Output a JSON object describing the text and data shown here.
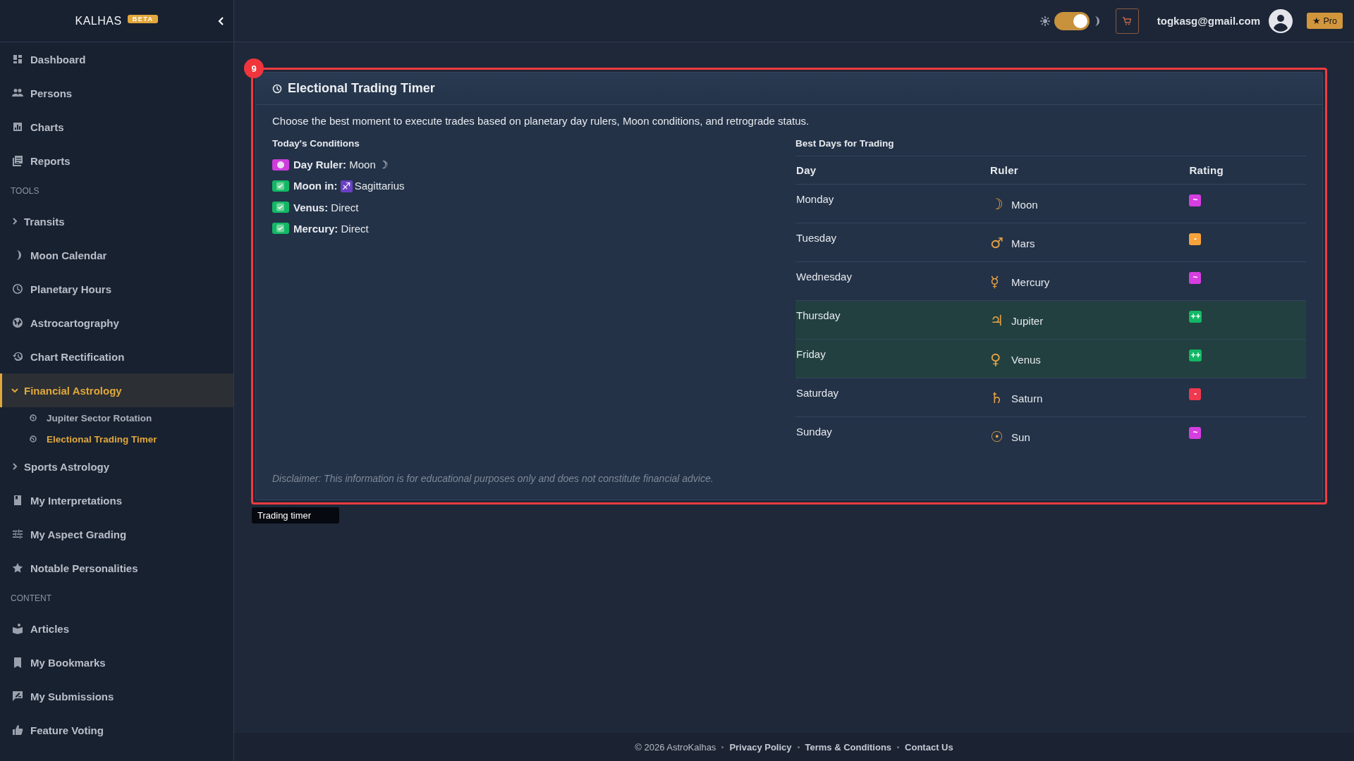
{
  "sidebar": {
    "brand": "KALHAS",
    "brand_badge": "BETA",
    "items": [
      {
        "kind": "link",
        "label": "Dashboard"
      },
      {
        "kind": "link",
        "label": "Persons"
      },
      {
        "kind": "link",
        "label": "Charts"
      },
      {
        "kind": "link",
        "label": "Reports"
      },
      {
        "kind": "heading",
        "label": "TOOLS"
      },
      {
        "kind": "group",
        "label": "Transits",
        "expanded": false
      },
      {
        "kind": "link",
        "label": "Moon Calendar"
      },
      {
        "kind": "link",
        "label": "Planetary Hours"
      },
      {
        "kind": "link",
        "label": "Astrocartography"
      },
      {
        "kind": "link",
        "label": "Chart Rectification"
      },
      {
        "kind": "group",
        "label": "Financial Astrology",
        "expanded": true,
        "children": [
          {
            "label": "Jupiter Sector Rotation",
            "selected": false
          },
          {
            "label": "Electional Trading Timer",
            "selected": true
          }
        ]
      },
      {
        "kind": "group",
        "label": "Sports Astrology",
        "expanded": false
      },
      {
        "kind": "link",
        "label": "My Interpretations"
      },
      {
        "kind": "link",
        "label": "My Aspect Grading"
      },
      {
        "kind": "link",
        "label": "Notable Personalities"
      },
      {
        "kind": "heading",
        "label": "CONTENT"
      },
      {
        "kind": "link",
        "label": "Articles"
      },
      {
        "kind": "link",
        "label": "My Bookmarks"
      },
      {
        "kind": "link",
        "label": "My Submissions"
      },
      {
        "kind": "link",
        "label": "Feature Voting"
      }
    ]
  },
  "header": {
    "theme_toggle": {
      "on": true
    },
    "email": "togkasg@gmail.com",
    "pro_badge": "★ Pro"
  },
  "annotation": {
    "number": "9",
    "caption": "Trading timer"
  },
  "card": {
    "title": "Electional Trading Timer",
    "description": "Choose the best moment to execute trades based on planetary day rulers, Moon conditions, and retrograde status.",
    "conditions_title": "Today's Conditions",
    "conditions": [
      {
        "kind": "moon",
        "label": "Day Ruler:",
        "value": "Moon ☽"
      },
      {
        "kind": "check",
        "label": "Moon in:",
        "sign": "♐",
        "value": "Sagittarius"
      },
      {
        "kind": "check",
        "label": "Venus:",
        "value": "Direct"
      },
      {
        "kind": "check",
        "label": "Mercury:",
        "value": "Direct"
      }
    ],
    "best_days_title": "Best Days for Trading",
    "table": {
      "columns": [
        "Day",
        "Ruler",
        "Rating"
      ],
      "rows": [
        {
          "day": "Monday",
          "symbol": "☽",
          "ruler": "Moon",
          "rating": "~",
          "color": "#d63ee0",
          "highlighted": false
        },
        {
          "day": "Tuesday",
          "symbol": "♂",
          "ruler": "Mars",
          "rating": "-",
          "color": "#f7a23b",
          "highlighted": false
        },
        {
          "day": "Wednesday",
          "symbol": "☿",
          "ruler": "Mercury",
          "rating": "~",
          "color": "#d63ee0",
          "highlighted": false
        },
        {
          "day": "Thursday",
          "symbol": "♃",
          "ruler": "Jupiter",
          "rating": "++",
          "color": "#12b865",
          "highlighted": true
        },
        {
          "day": "Friday",
          "symbol": "♀",
          "ruler": "Venus",
          "rating": "++",
          "color": "#12b865",
          "highlighted": true
        },
        {
          "day": "Saturday",
          "symbol": "♄",
          "ruler": "Saturn",
          "rating": "-",
          "color": "#f0384f",
          "highlighted": false
        },
        {
          "day": "Sunday",
          "symbol": "☉",
          "ruler": "Sun",
          "rating": "~",
          "color": "#d63ee0",
          "highlighted": false
        }
      ]
    },
    "disclaimer": "Disclaimer: This information is for educational purposes only and does not constitute financial advice."
  },
  "footer": {
    "copyright": "© 2026 AstroKalhas",
    "links": [
      "Privacy Policy",
      "Terms & Conditions",
      "Contact Us"
    ]
  }
}
